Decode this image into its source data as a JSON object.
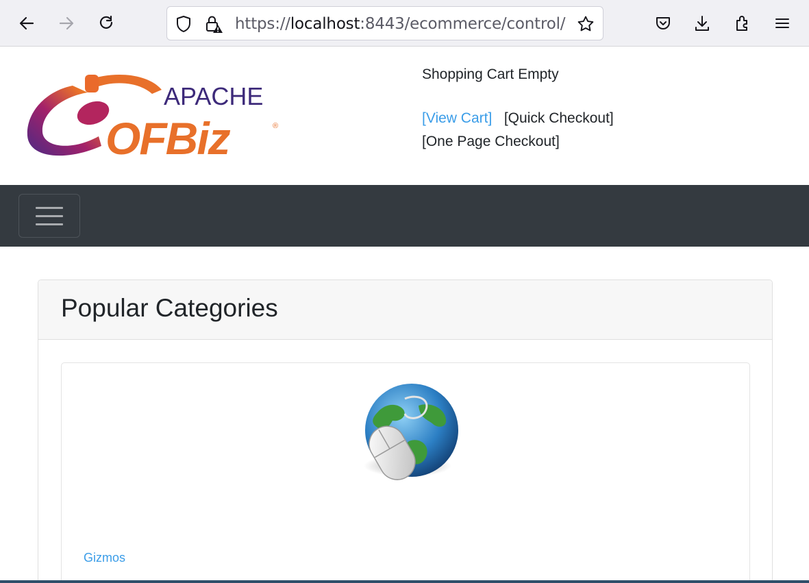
{
  "browser": {
    "url_prefix": "https://",
    "url_host": "localhost",
    "url_rest": ":8443/ecommerce/control/"
  },
  "header": {
    "logo_top": "APACHE",
    "logo_main": "OFBiz",
    "cart_status": "Shopping Cart Empty",
    "view_cart": "[View Cart]",
    "quick_checkout": "[Quick Checkout]",
    "one_page_checkout": "[One Page Checkout]"
  },
  "main": {
    "section_title": "Popular Categories",
    "categories": [
      {
        "label": "Gizmos",
        "icon": "globe-mouse-icon"
      }
    ]
  },
  "colors": {
    "navbar": "#343a40",
    "link": "#3b9de8",
    "logo_orange": "#e8702a",
    "logo_purple": "#5b2a86"
  }
}
